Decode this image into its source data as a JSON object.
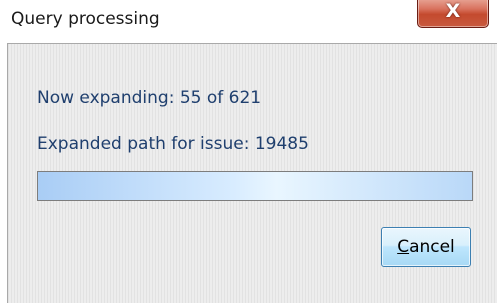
{
  "window": {
    "title": "Query processing",
    "close_glyph": "X"
  },
  "status": {
    "expanding_text": "Now expanding: 55 of 621",
    "path_text": "Expanded path for issue: 19485"
  },
  "progress": {
    "value": 1.0,
    "fill_color": "#a9cdf5"
  },
  "buttons": {
    "cancel_mnemonic": "C",
    "cancel_rest": "ancel"
  },
  "icons": {
    "close": "close-icon"
  }
}
